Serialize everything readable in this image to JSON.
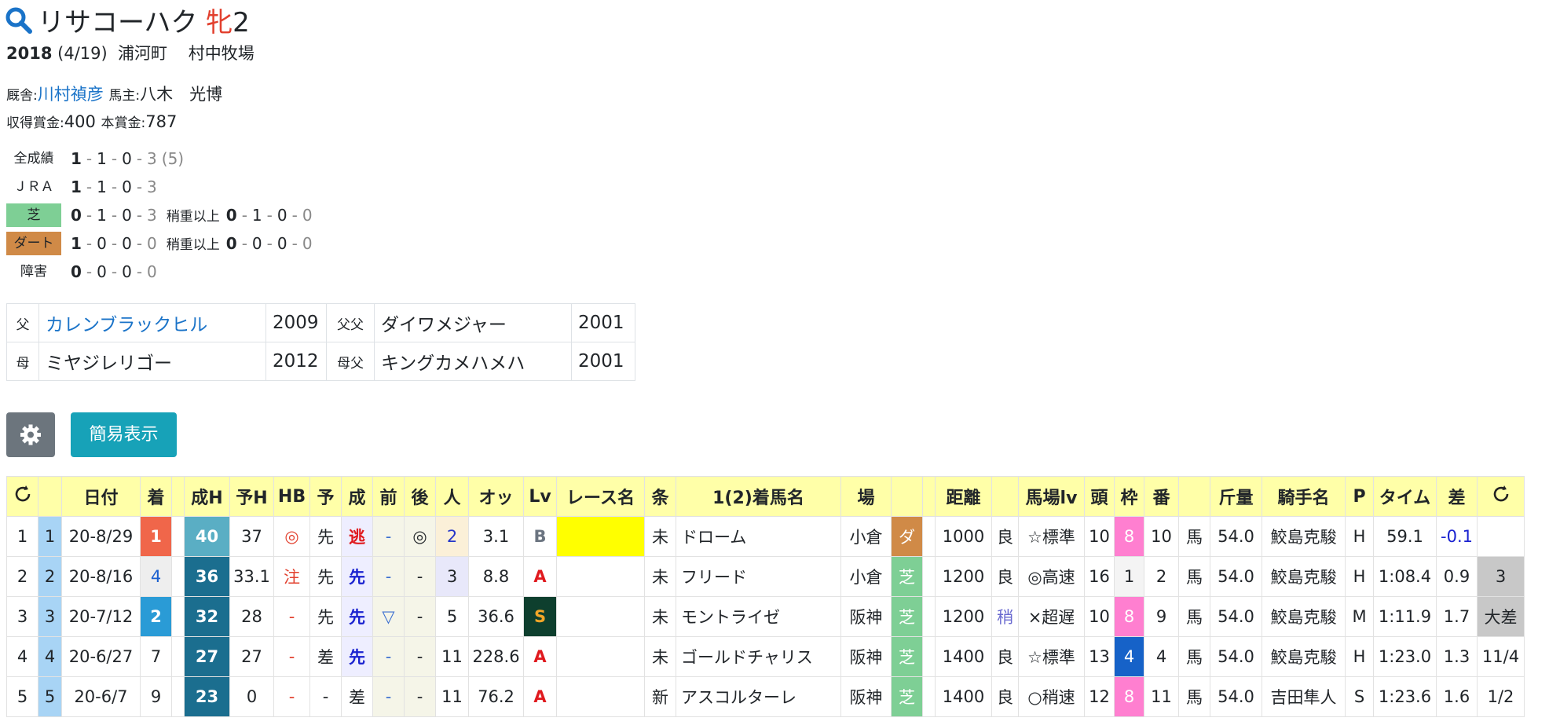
{
  "horse": {
    "name": "リサコーハク",
    "sex_age": "牝２",
    "search_icon": "search-icon"
  },
  "birth": {
    "year": "2018",
    "date": "(4/19)",
    "place": "浦河町",
    "farm": "村中牧場"
  },
  "trainer": {
    "label": "厩舎:",
    "name": "川村禎彦",
    "owner_label": "馬主:",
    "owner": "八木　光博"
  },
  "earnings": {
    "label1": "収得賞金:",
    "value1": "400",
    "label2": "本賞金:",
    "value2": "787"
  },
  "records": [
    {
      "label": "全成績",
      "v": [
        "1",
        "1",
        "0",
        "3"
      ],
      "extra": "(5)"
    },
    {
      "label": "ＪＲＡ",
      "v": [
        "1",
        "1",
        "0",
        "3"
      ]
    },
    {
      "label": "芝",
      "v": [
        "0",
        "1",
        "0",
        "3"
      ],
      "sub_label": "稍重以上",
      "sub": [
        "0",
        "1",
        "0",
        "0"
      ]
    },
    {
      "label": "ダート",
      "v": [
        "1",
        "0",
        "0",
        "0"
      ],
      "sub_label": "稍重以上",
      "sub": [
        "0",
        "0",
        "0",
        "0"
      ]
    },
    {
      "label": "障害",
      "v": [
        "0",
        "0",
        "0",
        "0"
      ]
    }
  ],
  "pedigree": [
    {
      "l1": "父",
      "n1": "カレンブラックヒル",
      "y1": "2009",
      "l2": "父父",
      "n2": "ダイワメジャー",
      "y2": "2001"
    },
    {
      "l1": "母",
      "n1": "ミヤジレリゴー",
      "y1": "2012",
      "l2": "母父",
      "n2": "キングカメハメハ",
      "y2": "2001"
    }
  ],
  "buttons": {
    "settings_icon": "gear-icon",
    "simple": "簡易表示"
  },
  "results": {
    "headers": [
      "",
      "",
      "日付",
      "着",
      "",
      "成H",
      "予H",
      "HB",
      "予",
      "成",
      "前",
      "後",
      "人",
      "オッ",
      "Lv",
      "レース名",
      "条",
      "1(2)着馬名",
      "場",
      "",
      "",
      "距離",
      "",
      "馬場lv",
      "頭",
      "枠",
      "番",
      "",
      "斤量",
      "騎手名",
      "P",
      "タイム",
      "差",
      ""
    ],
    "rows": [
      {
        "no": "1",
        "i": "1",
        "date": "20-8/29",
        "pos": "1",
        "seiH": "40",
        "yoH": "37",
        "hb": "◎",
        "yo": "先",
        "sei": "逃",
        "mae": "-",
        "ato": "◎",
        "pop": "2",
        "odds": "3.1",
        "lv": "B",
        "race": "",
        "cond": "未",
        "winner": "ドローム",
        "place": "小倉",
        "track": "ダ",
        "dist": "1000",
        "baba": "良",
        "babalv": "☆標準",
        "heads": "10",
        "waku": "8",
        "ban": "10",
        "uma": "馬",
        "kin": "54.0",
        "jockey": "鮫島克駿",
        "p": "H",
        "time": "59.1",
        "diff": "-0.1",
        "last": ""
      },
      {
        "no": "2",
        "i": "2",
        "date": "20-8/16",
        "pos": "4",
        "seiH": "36",
        "yoH": "33.1",
        "hb": "注",
        "yo": "先",
        "sei": "先",
        "mae": "-",
        "ato": "-",
        "pop": "3",
        "odds": "8.8",
        "lv": "A",
        "race": "",
        "cond": "未",
        "winner": "フリード",
        "place": "小倉",
        "track": "芝",
        "dist": "1200",
        "baba": "良",
        "babalv": "◎高速",
        "heads": "16",
        "waku": "1",
        "ban": "2",
        "uma": "馬",
        "kin": "54.0",
        "jockey": "鮫島克駿",
        "p": "H",
        "time": "1:08.4",
        "diff": "0.9",
        "last": "3"
      },
      {
        "no": "3",
        "i": "3",
        "date": "20-7/12",
        "pos": "2",
        "seiH": "32",
        "yoH": "28",
        "hb": "-",
        "yo": "先",
        "sei": "先",
        "mae": "▽",
        "ato": "-",
        "pop": "5",
        "odds": "36.6",
        "lv": "S",
        "race": "",
        "cond": "未",
        "winner": "モントライゼ",
        "place": "阪神",
        "track": "芝",
        "dist": "1200",
        "baba": "稍",
        "babalv": "×超遅",
        "heads": "10",
        "waku": "8",
        "ban": "9",
        "uma": "馬",
        "kin": "54.0",
        "jockey": "鮫島克駿",
        "p": "M",
        "time": "1:11.9",
        "diff": "1.7",
        "last": "大差"
      },
      {
        "no": "4",
        "i": "4",
        "date": "20-6/27",
        "pos": "7",
        "seiH": "27",
        "yoH": "27",
        "hb": "-",
        "yo": "差",
        "sei": "先",
        "mae": "-",
        "ato": "-",
        "pop": "11",
        "odds": "228.6",
        "lv": "A",
        "race": "",
        "cond": "未",
        "winner": "ゴールドチャリス",
        "place": "阪神",
        "track": "芝",
        "dist": "1400",
        "baba": "良",
        "babalv": "☆標準",
        "heads": "13",
        "waku": "4",
        "ban": "4",
        "uma": "馬",
        "kin": "54.0",
        "jockey": "鮫島克駿",
        "p": "H",
        "time": "1:23.0",
        "diff": "1.3",
        "last": "11/4"
      },
      {
        "no": "5",
        "i": "5",
        "date": "20-6/7",
        "pos": "9",
        "seiH": "23",
        "yoH": "0",
        "hb": "-",
        "yo": "-",
        "sei": "差",
        "mae": "-",
        "ato": "-",
        "pop": "11",
        "odds": "76.2",
        "lv": "A",
        "race": "",
        "cond": "新",
        "winner": "アスコルターレ",
        "place": "阪神",
        "track": "芝",
        "dist": "1400",
        "baba": "良",
        "babalv": "○稍速",
        "heads": "12",
        "waku": "8",
        "ban": "11",
        "uma": "馬",
        "kin": "54.0",
        "jockey": "吉田隼人",
        "p": "S",
        "time": "1:23.6",
        "diff": "1.6",
        "last": "1/2"
      }
    ]
  }
}
